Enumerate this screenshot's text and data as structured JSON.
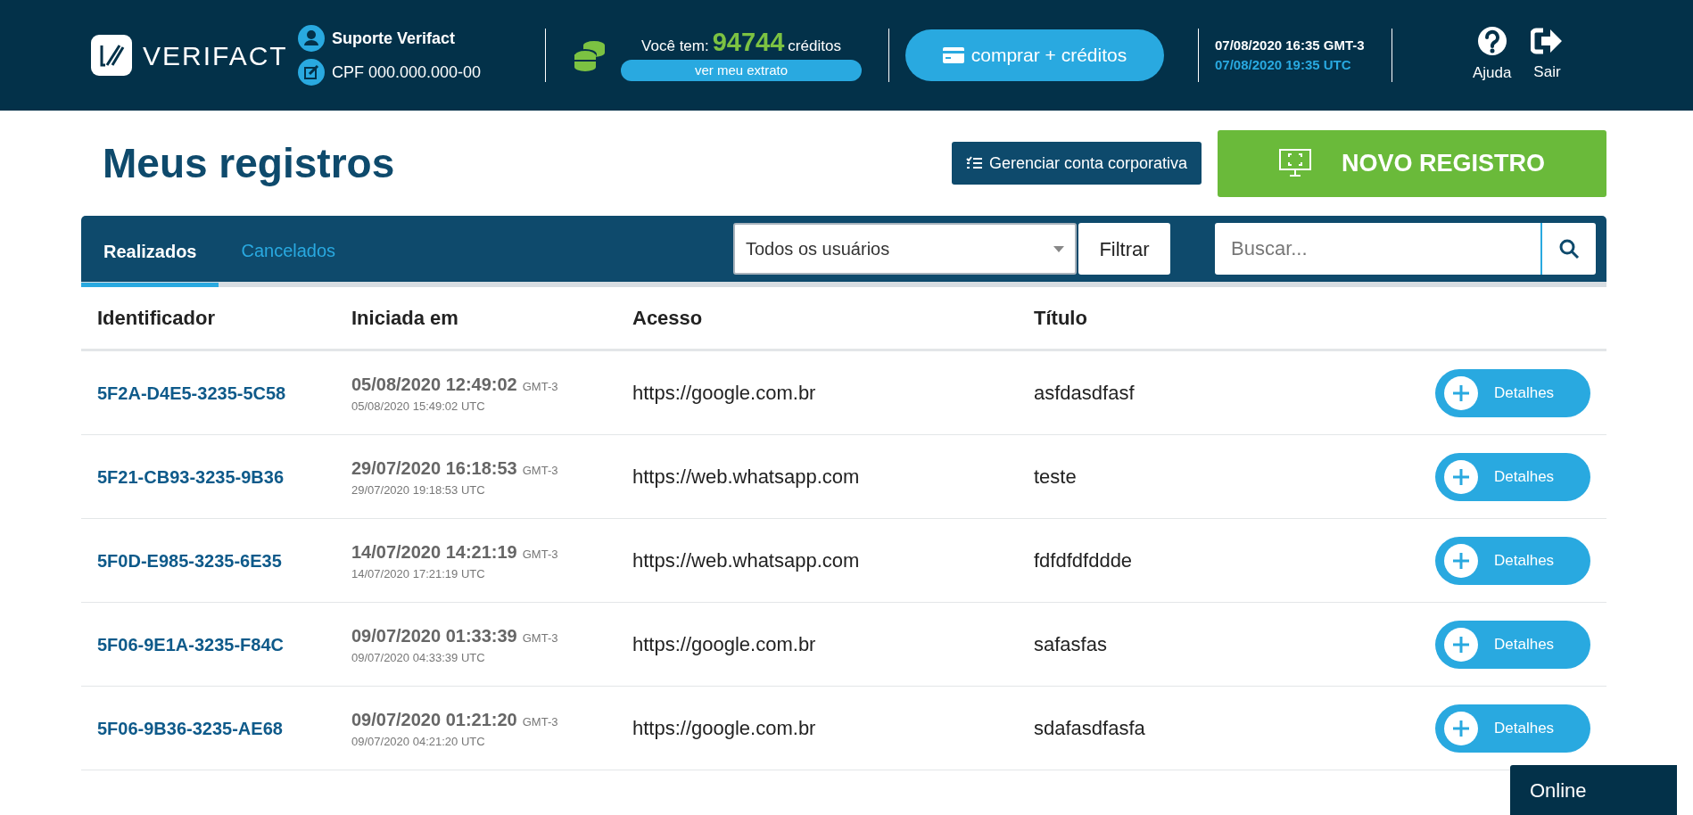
{
  "header": {
    "logo_text": "VERIFACT",
    "user_name": "Suporte Verifact",
    "user_cpf": "CPF 000.000.000-00",
    "credits_prefix": "Você tem:",
    "credits_amount": "94744",
    "credits_suffix": "créditos",
    "statement_button": "ver meu extrato",
    "buy_button": "comprar + créditos",
    "time_local": "07/08/2020 16:35 GMT-3",
    "time_utc": "07/08/2020 19:35 UTC",
    "actions": [
      {
        "kind": "help",
        "label": "Ajuda"
      },
      {
        "kind": "exit",
        "label": "Sair"
      }
    ]
  },
  "page_title": "Meus registros",
  "manage_button": "Gerenciar conta corporativa",
  "new_button": "NOVO REGISTRO",
  "tabs": [
    {
      "label": "Realizados",
      "selected": true
    },
    {
      "label": "Cancelados",
      "selected": false
    }
  ],
  "user_filter": {
    "value": "Todos os usuários"
  },
  "filter_button": "Filtrar",
  "search": {
    "placeholder": "Buscar..."
  },
  "table": {
    "columns": [
      "Identificador",
      "Iniciada em",
      "Acesso",
      "Título"
    ],
    "rows": [
      {
        "id": "5F2A-D4E5-3235-5C58",
        "started_local": "05/08/2020 12:49:02",
        "started_tz": "GMT-3",
        "started_utc": "05/08/2020 15:49:02 UTC",
        "access": "https://google.com.br",
        "title": "asfdasdfasf",
        "action": "Detalhes"
      },
      {
        "id": "5F21-CB93-3235-9B36",
        "started_local": "29/07/2020 16:18:53",
        "started_tz": "GMT-3",
        "started_utc": "29/07/2020 19:18:53 UTC",
        "access": "https://web.whatsapp.com",
        "title": "teste",
        "action": "Detalhes"
      },
      {
        "id": "5F0D-E985-3235-6E35",
        "started_local": "14/07/2020 14:21:19",
        "started_tz": "GMT-3",
        "started_utc": "14/07/2020 17:21:19 UTC",
        "access": "https://web.whatsapp.com",
        "title": "fdfdfdfddde",
        "action": "Detalhes"
      },
      {
        "id": "5F06-9E1A-3235-F84C",
        "started_local": "09/07/2020 01:33:39",
        "started_tz": "GMT-3",
        "started_utc": "09/07/2020 04:33:39 UTC",
        "access": "https://google.com.br",
        "title": "safasfas",
        "action": "Detalhes"
      },
      {
        "id": "5F06-9B36-3235-AE68",
        "started_local": "09/07/2020 01:21:20",
        "started_tz": "GMT-3",
        "started_utc": "09/07/2020 04:21:20 UTC",
        "access": "https://google.com.br",
        "title": "sdafasdfasfa",
        "action": "Detalhes"
      }
    ]
  },
  "chat": {
    "label": "Online"
  }
}
